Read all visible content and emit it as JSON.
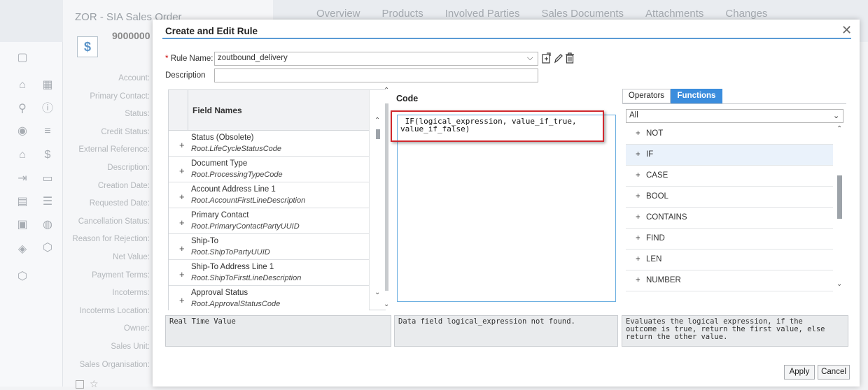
{
  "background": {
    "order_title": "ZOR - SIA Sales Order",
    "order_id": "9000000",
    "tabs": [
      "Overview",
      "Products",
      "Involved Parties",
      "Sales Documents",
      "Attachments",
      "Changes"
    ],
    "fields": [
      "Account:",
      "Primary Contact:",
      "Status:",
      "Credit Status:",
      "External Reference:",
      "Description:",
      "Creation Date:",
      "Requested Date:",
      "Cancellation Status:",
      "Reason for Rejection:",
      "Net Value:",
      "Payment Terms:",
      "Incoterms:",
      "Incoterms Location:",
      "Owner:",
      "Sales Unit:",
      "Sales Organisation:"
    ]
  },
  "modal": {
    "title": "Create and Edit Rule",
    "close_glyph": "✕",
    "rule_name_required": "*",
    "rule_name_label": "Rule Name:",
    "rule_name_value": "zoutbound_delivery",
    "description_label": "Description",
    "field_names_header": "Field Names",
    "fields": [
      {
        "name": "Status (Obsolete)",
        "path": "Root.LifeCycleStatusCode"
      },
      {
        "name": "Document Type",
        "path": "Root.ProcessingTypeCode"
      },
      {
        "name": "Account Address Line 1",
        "path": "Root.AccountFirstLineDescription"
      },
      {
        "name": "Primary Contact",
        "path": "Root.PrimaryContactPartyUUID"
      },
      {
        "name": "Ship-To",
        "path": "Root.ShipToPartyUUID"
      },
      {
        "name": "Ship-To Address Line 1",
        "path": "Root.ShipToFirstLineDescription"
      },
      {
        "name": "Approval Status",
        "path": "Root.ApprovalStatusCode"
      }
    ],
    "code_title": "Code",
    "code_line1": " IF(logical_expression, value_if_true,",
    "code_line2": "value_if_false)",
    "tab_operators": "Operators",
    "tab_functions": "Functions",
    "function_filter": "All",
    "functions": [
      "NOT",
      "IF",
      "CASE",
      "BOOL",
      "CONTAINS",
      "FIND",
      "LEN",
      "NUMBER"
    ],
    "real_time_value_label": "Real Time Value",
    "code_message": "Data field logical_expression not found.",
    "function_description_line1": "Evaluates the logical expression, if the",
    "function_description_line2": "outcome is true, return the first value, else",
    "function_description_line3": "return the other value.",
    "apply_label": "Apply",
    "cancel_label": "Cancel"
  }
}
